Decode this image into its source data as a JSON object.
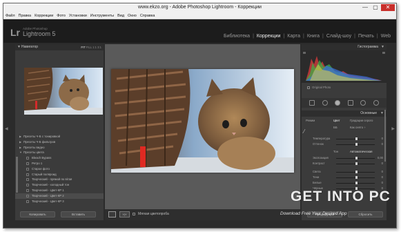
{
  "window": {
    "title": "www.ekzo.org - Adobe Photoshop Lightroom - Коррекции",
    "min": "—",
    "max": "▢",
    "close": "✕"
  },
  "menu": [
    "Файл",
    "Правка",
    "Коррекции",
    "Фото",
    "Установки",
    "Инструменты",
    "Вид",
    "Окно",
    "Справка"
  ],
  "header": {
    "logo": "Lr",
    "sub": "Adobe Photoshop",
    "name": "Lightroom 5",
    "modules": [
      "Библиотека",
      "Коррекции",
      "Карта",
      "Книга",
      "Слайд-шоу",
      "Печать",
      "Web"
    ],
    "active_module": "Коррекции"
  },
  "navigator": {
    "title": "Навигатор",
    "options": [
      "FIT",
      "FILL",
      "1:1",
      "3:1"
    ]
  },
  "presets": [
    {
      "label": "Пресеты Ч-Б с тонировкой",
      "child": false
    },
    {
      "label": "Пресеты Ч-Б фильтров",
      "child": false
    },
    {
      "label": "Пресеты видео",
      "child": false
    },
    {
      "label": "Пресеты цвета",
      "child": false
    },
    {
      "label": "Bleach Bypass",
      "child": true
    },
    {
      "label": "Ретро 1",
      "child": true
    },
    {
      "label": "Старое фото",
      "child": true
    },
    {
      "label": "Старый поляроид",
      "child": true
    },
    {
      "label": "Творческий - прямой по вітая",
      "child": true
    },
    {
      "label": "Творческий - холодный тон",
      "child": true
    },
    {
      "label": "Творческий - Цвет-КР 1",
      "child": true
    },
    {
      "label": "Творческий - Цвет-КР 2",
      "child": true
    },
    {
      "label": "Творческий - Цвет-КР 3",
      "child": true
    }
  ],
  "left_buttons": {
    "copy": "Копировать",
    "paste": "Вставить"
  },
  "toolbar": {
    "view_label": "Мягкая цветопроба"
  },
  "histogram": {
    "title": "Гистограмма",
    "original_photo": "Original Photo"
  },
  "basic": {
    "title": "Основные",
    "treatment_label": "Режим",
    "treatment_color": "Цвет",
    "treatment_bw": "Градации серого",
    "wb_label": "ББ",
    "wb_value": "Как снято ÷",
    "rows": [
      {
        "label": "Температура",
        "value": "0"
      },
      {
        "label": "Оттенок",
        "value": "0"
      }
    ],
    "tone_label": "Тон",
    "tone_auto": "Автоматическая",
    "tone_rows": [
      {
        "label": "Экспозиция",
        "value": "0,00"
      },
      {
        "label": "Контраст",
        "value": "0"
      },
      {
        "label": "Света",
        "value": "0"
      },
      {
        "label": "Тени",
        "value": "0"
      },
      {
        "label": "Белые",
        "value": "0"
      },
      {
        "label": "Чёрные",
        "value": "0"
      }
    ]
  },
  "right_buttons": {
    "prev": "Предыдущий",
    "reset": "Сбросить"
  },
  "watermark": {
    "main": "GET INTO PC",
    "sub": "Download Free Your Desired App"
  },
  "colors": {
    "bg": "#2b2b2b",
    "panel": "#3b3b3b",
    "accent": "#f0f0f0"
  }
}
